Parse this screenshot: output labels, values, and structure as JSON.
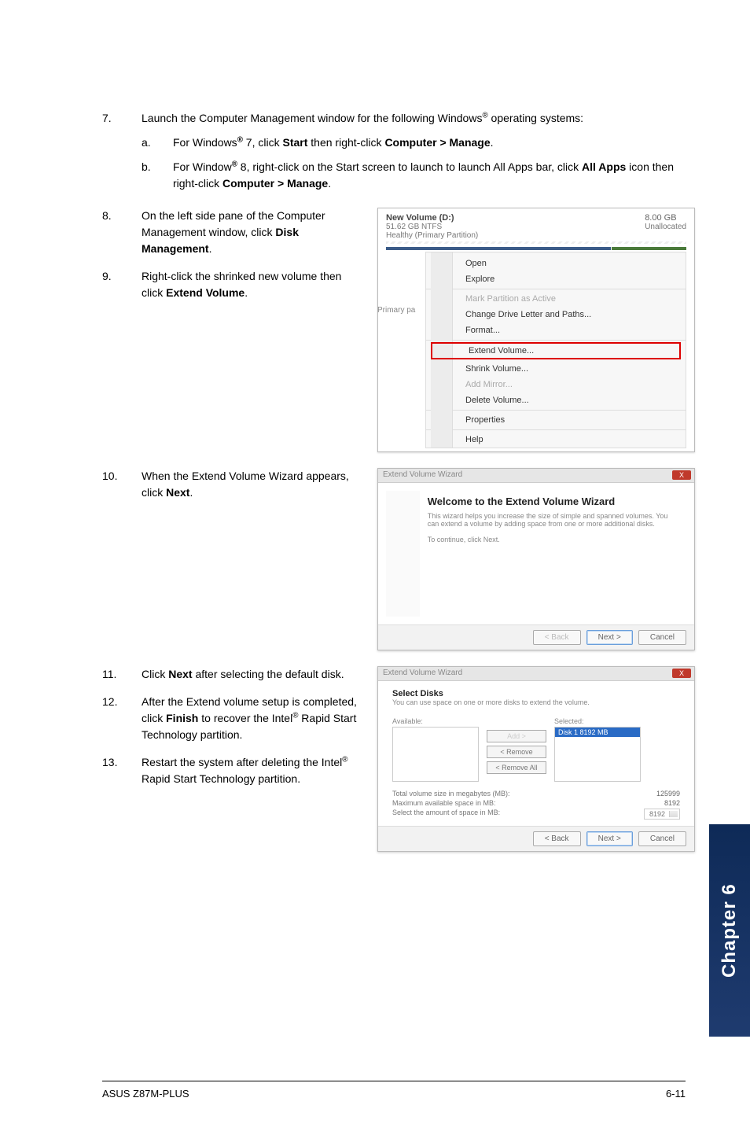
{
  "steps": {
    "s7": {
      "num": "7.",
      "text_a": "Launch the Computer Management window for the following Windows",
      "text_b": " operating systems:",
      "sub_a": {
        "letter": "a.",
        "pre": "For Windows",
        "mid": " 7, click ",
        "b1": "Start",
        "mid2": " then right-click ",
        "b2": "Computer > Manage",
        "post": "."
      },
      "sub_b": {
        "letter": "b.",
        "pre": "For Window",
        "mid": " 8, right-click on the Start screen to launch to launch All Apps bar, click ",
        "b1": "All Apps",
        "mid2": " icon then right-click ",
        "b2": "Computer > Manage",
        "post": "."
      }
    },
    "s8": {
      "num": "8.",
      "text_a": "On the left side pane of the Computer Management window, click ",
      "b1": "Disk Management",
      "post": "."
    },
    "s9": {
      "num": "9.",
      "text": "Right-click the shrinked new volume then click ",
      "b1": "Extend Volume",
      "post": "."
    },
    "s10": {
      "num": "10.",
      "text": "When the Extend Volume Wizard appears, click ",
      "b1": "Next",
      "post": "."
    },
    "s11": {
      "num": "11.",
      "text": "Click ",
      "b1": "Next",
      "post": " after selecting the default disk."
    },
    "s12": {
      "num": "12.",
      "text_a": "After the Extend volume setup is completed, click ",
      "b1": "Finish",
      "text_b": " to recover the Intel",
      "text_c": "  Rapid Start Technology partition."
    },
    "s13": {
      "num": "13.",
      "text_a": "Restart the system after deleting the Intel",
      "text_b": " Rapid Start Technology partition."
    }
  },
  "reg": "®",
  "ss1": {
    "vol_title": "New Volume  (D:)",
    "vol_size": "51.62 GB NTFS",
    "vol_status": "Healthy (Primary Partition)",
    "unalloc_size": "8.00 GB",
    "unalloc_label": "Unallocated",
    "sidebar": "Primary pa",
    "menu": {
      "open": "Open",
      "explore": "Explore",
      "mark": "Mark Partition as Active",
      "change": "Change Drive Letter and Paths...",
      "format": "Format...",
      "extend": "Extend Volume...",
      "shrink": "Shrink Volume...",
      "mirror": "Add Mirror...",
      "delete": "Delete Volume...",
      "props": "Properties",
      "help": "Help"
    }
  },
  "ss2": {
    "bar": "Extend Volume Wizard",
    "x": "X",
    "title": "Welcome to the Extend Volume Wizard",
    "desc1": "This wizard helps you increase the size of simple and spanned volumes. You can extend a volume by adding space from one or more additional disks.",
    "desc2": "To continue, click Next.",
    "back": "< Back",
    "next": "Next >",
    "cancel": "Cancel"
  },
  "ss3": {
    "bar": "Extend Volume Wizard",
    "x": "X",
    "title": "Select Disks",
    "sub": "You can use space on one or more disks to extend the volume.",
    "available": "Available:",
    "selected": "Selected:",
    "sel_row": "Disk 1    8192 MB",
    "add": "Add >",
    "remove": "< Remove",
    "removeall": "< Remove All",
    "rows": {
      "total": {
        "label": "Total volume size in megabytes (MB):",
        "value": "125999"
      },
      "max": {
        "label": "Maximum available space in MB:",
        "value": "8192"
      },
      "sel": {
        "label": "Select the amount of space in MB:",
        "value": "8192"
      }
    },
    "back": "< Back",
    "next": "Next >",
    "cancel": "Cancel"
  },
  "chapter": "Chapter 6",
  "footer": {
    "left": "ASUS Z87M-PLUS",
    "right": "6-11"
  }
}
